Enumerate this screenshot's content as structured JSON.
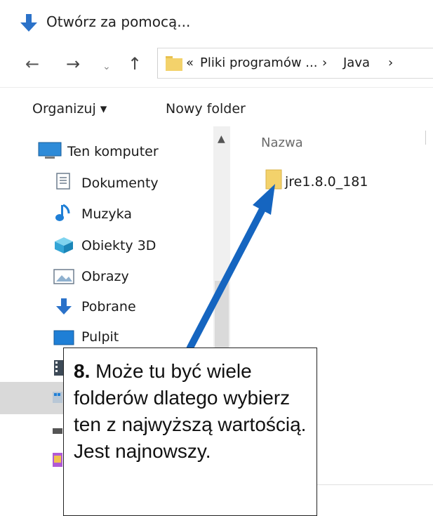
{
  "window": {
    "title": "Otwórz za pomocą..."
  },
  "navigation": {
    "back_label": "←",
    "forward_label": "→",
    "recent_label": "⌄",
    "up_label": "↑",
    "breadcrumb": {
      "overflow": "«",
      "items": [
        "Pliki programów ...",
        "Java"
      ],
      "separator": "›"
    }
  },
  "toolbar": {
    "organize_label": "Organizuj ▾",
    "new_folder_label": "Nowy folder"
  },
  "sidebar": {
    "items": [
      {
        "label": "Ten komputer",
        "icon": "computer-icon"
      },
      {
        "label": "Dokumenty",
        "icon": "documents-icon"
      },
      {
        "label": "Muzyka",
        "icon": "music-icon"
      },
      {
        "label": "Obiekty 3D",
        "icon": "objects-3d-icon"
      },
      {
        "label": "Obrazy",
        "icon": "pictures-icon"
      },
      {
        "label": "Pobrane",
        "icon": "downloads-icon"
      },
      {
        "label": "Pulpit",
        "icon": "desktop-icon"
      }
    ]
  },
  "content": {
    "column_name": "Nazwa",
    "files": [
      {
        "name": "jre1.8.0_181",
        "icon": "folder-icon"
      }
    ]
  },
  "callout": {
    "number": "8.",
    "text": "Może tu być wiele folderów dlatego wybierz ten z najwyższą wartością. Jest najnowszy."
  },
  "colors": {
    "arrow": "#1565c0",
    "folder": "#f3d26b",
    "selection": "#d9d9d9"
  }
}
